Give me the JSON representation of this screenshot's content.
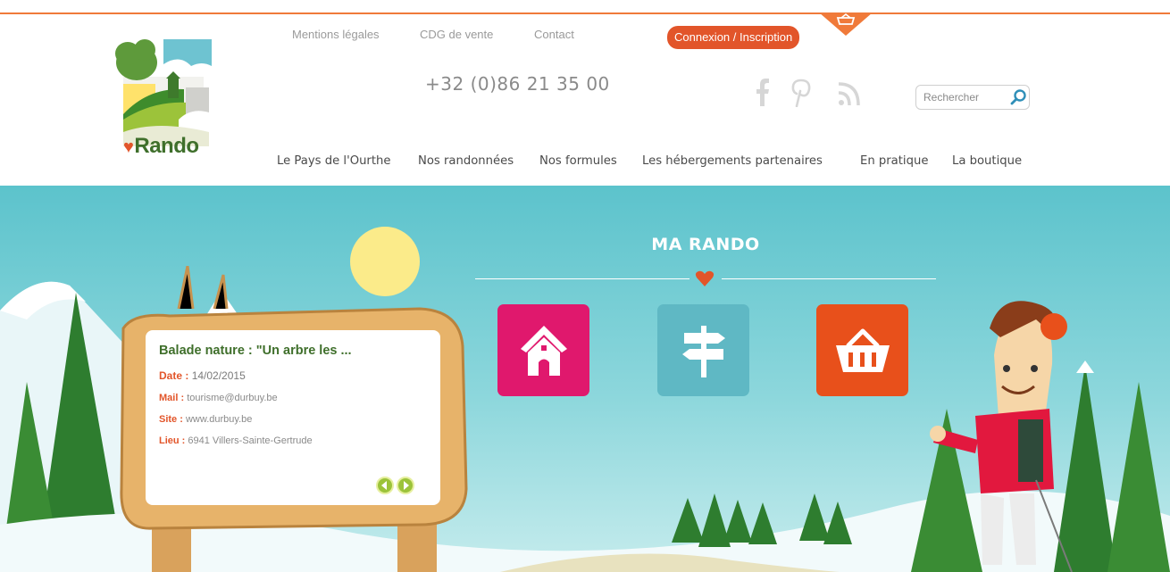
{
  "top_links": [
    "Mentions légales",
    "CDG de vente",
    "Contact"
  ],
  "login_label": "Connexion / Inscription",
  "phone": "+32 (0)86 21 35 00",
  "logo_text": "Rando",
  "search_placeholder": "Rechercher",
  "social_icons": [
    "facebook-icon",
    "pinterest-icon",
    "rss-icon"
  ],
  "nav": [
    "Le Pays de l'Ourthe",
    "Nos randonnées",
    "Nos formules",
    "Les hébergements partenaires",
    "En pratique",
    "La boutique"
  ],
  "hero": {
    "title": "MA RANDO",
    "tiles": [
      {
        "icon": "house-icon",
        "color": "#e0186d"
      },
      {
        "icon": "signpost-icon",
        "color": "#5fb8c4"
      },
      {
        "icon": "basket-icon",
        "color": "#e8501b"
      }
    ]
  },
  "event": {
    "title": "Balade nature : \"Un arbre les ...",
    "date_label": "Date :",
    "date": "14/02/2015",
    "mail_label": "Mail :",
    "mail": "tourisme@durbuy.be",
    "site_label": "Site :",
    "site": "www.durbuy.be",
    "lieu_label": "Lieu :",
    "lieu": "6941 Villers-Sainte-Gertrude"
  },
  "colors": {
    "accent": "#e2552a",
    "green": "#3f6f2b",
    "sky": "#5cc3cc"
  }
}
